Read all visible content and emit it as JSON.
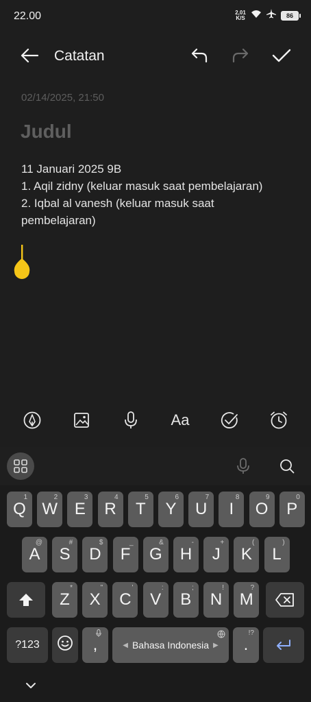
{
  "status_bar": {
    "time": "22.00",
    "net_speed_value": "2,01",
    "net_speed_unit": "K/S",
    "battery": "86"
  },
  "app_bar": {
    "title": "Catatan",
    "back_icon": "back-arrow-icon",
    "undo_icon": "undo-icon",
    "redo_icon": "redo-icon",
    "done_icon": "check-icon"
  },
  "note": {
    "date": "02/14/2025, 21:50",
    "title_placeholder": "Judul",
    "lines": [
      "11 Januari 2025 9B",
      "1. Aqil zidny (keluar masuk saat pembelajaran)",
      "2. Iqbal al vanesh (keluar masuk saat",
      "pembelajaran)"
    ]
  },
  "toolbar": [
    "handwriting-icon",
    "image-icon",
    "microphone-icon",
    "text-format-icon",
    "checklist-icon",
    "reminder-clock-icon"
  ],
  "toolbar_text_format_label": "Aa",
  "keyboard": {
    "row1": [
      {
        "k": "Q",
        "h": "1"
      },
      {
        "k": "W",
        "h": "2"
      },
      {
        "k": "E",
        "h": "3"
      },
      {
        "k": "R",
        "h": "4"
      },
      {
        "k": "T",
        "h": "5"
      },
      {
        "k": "Y",
        "h": "6"
      },
      {
        "k": "U",
        "h": "7"
      },
      {
        "k": "I",
        "h": "8"
      },
      {
        "k": "O",
        "h": "9"
      },
      {
        "k": "P",
        "h": "0"
      }
    ],
    "row2": [
      {
        "k": "A",
        "h": "@"
      },
      {
        "k": "S",
        "h": "#"
      },
      {
        "k": "D",
        "h": "$"
      },
      {
        "k": "F",
        "h": "_"
      },
      {
        "k": "G",
        "h": "&"
      },
      {
        "k": "H",
        "h": "-"
      },
      {
        "k": "J",
        "h": "+"
      },
      {
        "k": "K",
        "h": "("
      },
      {
        "k": "L",
        "h": ")"
      }
    ],
    "row3": [
      {
        "k": "Z",
        "h": "*"
      },
      {
        "k": "X",
        "h": "\""
      },
      {
        "k": "C",
        "h": "'"
      },
      {
        "k": "V",
        "h": ":"
      },
      {
        "k": "B",
        "h": ";"
      },
      {
        "k": "N",
        "h": "!"
      },
      {
        "k": "M",
        "h": "?"
      }
    ],
    "symbols_label": "?123",
    "comma": ",",
    "period": ".",
    "period_hint": "!?",
    "space_label": "Bahasa Indonesia"
  }
}
